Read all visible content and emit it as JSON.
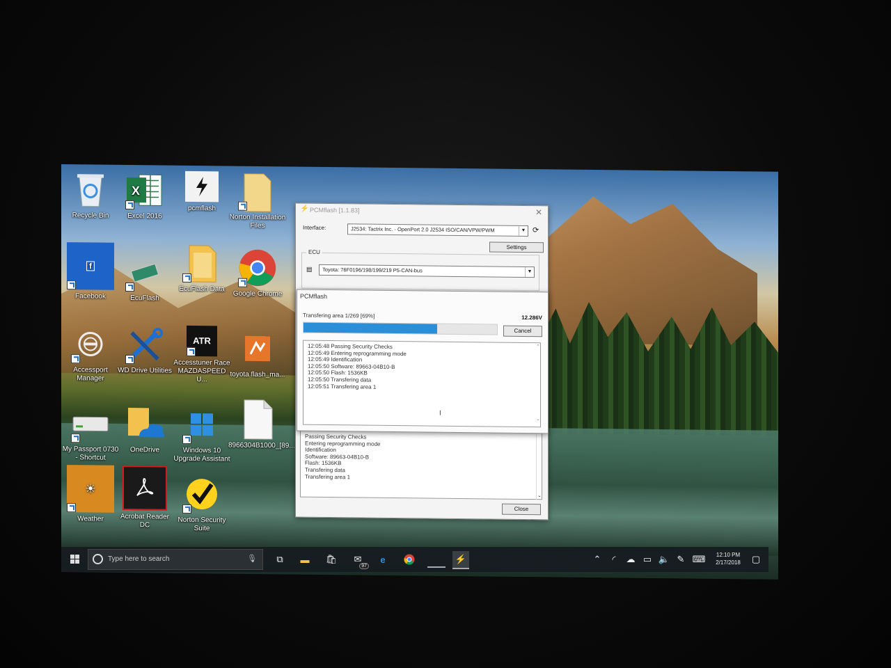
{
  "desktop": {
    "icons": [
      {
        "label": "Recycle Bin",
        "icon": "recycle-bin-icon"
      },
      {
        "label": "Excel 2016",
        "icon": "excel-icon"
      },
      {
        "label": "pcmflash",
        "icon": "pcmflash-icon"
      },
      {
        "label": "Norton Installation Files",
        "icon": "folder-icon"
      },
      {
        "label": "Facebook",
        "icon": "facebook-icon"
      },
      {
        "label": "EcuFlash",
        "icon": "ecuflash-icon"
      },
      {
        "label": "EcuFlash Data",
        "icon": "folder-icon"
      },
      {
        "label": "Google Chrome",
        "icon": "chrome-icon"
      },
      {
        "label": "Accessport Manager",
        "icon": "accessport-icon"
      },
      {
        "label": "WD Drive Utilities",
        "icon": "wd-tools-icon"
      },
      {
        "label": "Accesstuner Race MAZDASPEED U...",
        "icon": "atr-icon"
      },
      {
        "label": "toyota flash_ma...",
        "icon": "toyota-flash-icon"
      },
      {
        "label": "My Passport 0730 - Shortcut",
        "icon": "drive-icon"
      },
      {
        "label": "OneDrive",
        "icon": "onedrive-icon"
      },
      {
        "label": "Windows 10 Upgrade Assistant",
        "icon": "windows-icon"
      },
      {
        "label": "8966304B1000_[89...",
        "icon": "file-icon"
      },
      {
        "label": "Weather",
        "icon": "weather-icon"
      },
      {
        "label": "Acrobat Reader DC",
        "icon": "acrobat-icon"
      },
      {
        "label": "Norton Security Suite",
        "icon": "norton-icon"
      }
    ]
  },
  "main_window": {
    "title": "PCMflash [1.1.83]",
    "interface_label": "Interface:",
    "interface_value": "J2534: Tactrix Inc. - OpenPort 2.0 J2534 ISO/CAN/VPW/PWM",
    "settings_label": "Settings",
    "ecu_group_label": "ECU",
    "ecu_value": "Toyota: 76F0196/198/199/219 P5-CAN-bus",
    "log_lines": [
      "Passing Security Checks",
      "Entering reprogramming mode",
      "Identification",
      "Software: 89663-04B10-B",
      "Flash: 1536KB",
      "Transfering data",
      "Transfering area 1"
    ],
    "close_label": "Close"
  },
  "progress_dialog": {
    "title": "PCMflash",
    "status_text": "Transfering area 1/269 [69%]",
    "voltage": "12.286V",
    "progress_fraction": 0.69,
    "cancel_label": "Cancel",
    "log_lines": [
      "12:05:48 Passing Security Checks",
      "12:05:49 Entering reprogramming mode",
      "12:05:49 Identification",
      "12:05:50 Software: 89663-04B10-B",
      "12:05:50 Flash: 1536KB",
      "12:05:50 Transfering data",
      "12:05:51 Transfering area 1"
    ]
  },
  "taskbar": {
    "search_placeholder": "Type here to search",
    "mail_badge": "97",
    "time": "12:10 PM",
    "date": "2/17/2018"
  },
  "colors": {
    "progress": "#2b8fd8",
    "taskbar": "#161c20"
  }
}
